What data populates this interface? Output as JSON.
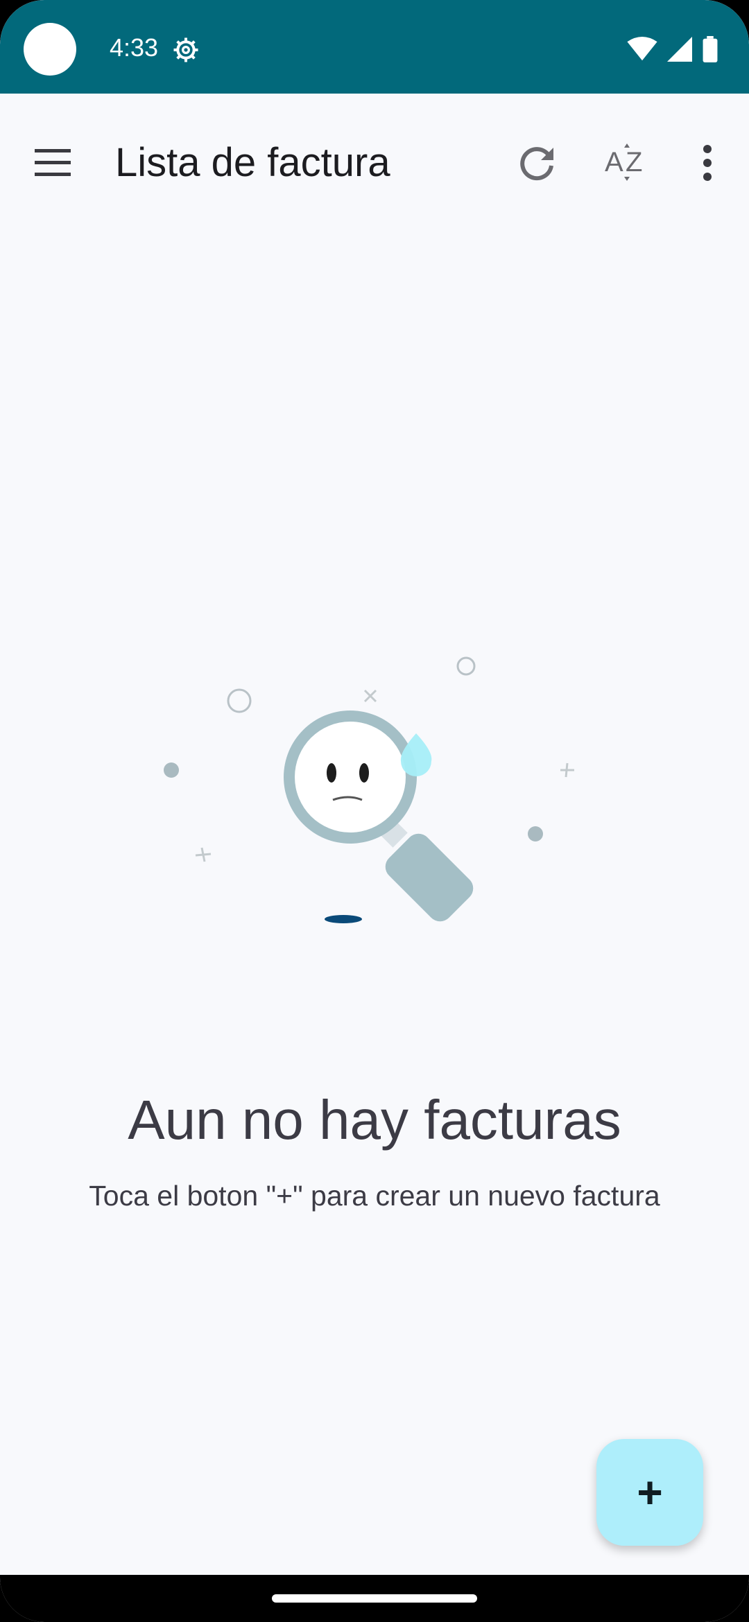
{
  "status_bar": {
    "time": "4:33",
    "icons": [
      "camera-cutout",
      "gear-icon",
      "wifi-icon",
      "signal-icon",
      "battery-icon"
    ],
    "bg_color": "#02697b"
  },
  "app_bar": {
    "title": "Lista de factura",
    "actions": [
      "menu-icon",
      "refresh-icon",
      "sort-az-icon",
      "more-vert-icon"
    ]
  },
  "empty_state": {
    "illustration": "sad-magnifier-illustration",
    "title": "Aun no hay facturas",
    "subtitle": "Toca el boton \"+\" para crear un nuevo factura"
  },
  "fab": {
    "label": "+",
    "color": "#aeeefb"
  }
}
